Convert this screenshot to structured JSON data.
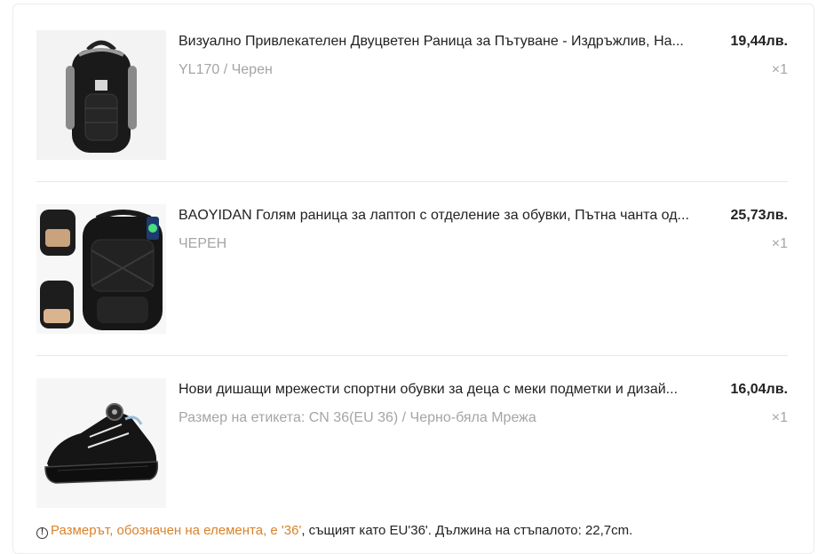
{
  "cart": {
    "items": [
      {
        "title": "Визуално Привлекателен Двуцветен Раница за Пътуване - Издръжлив, На...",
        "price": "19,44лв.",
        "variant": "YL170 / Черен",
        "qty": "×1",
        "image_icon": "backpack-black-grey-icon"
      },
      {
        "title": "BAOYIDAN Голям раница за лаптоп с отделение за обувки, Пътна чанта од...",
        "price": "25,73лв.",
        "variant": "ЧЕРЕН",
        "qty": "×1",
        "image_icon": "laptop-backpack-usb-icon"
      },
      {
        "title": "Нови дишащи мрежести спортни обувки за деца с меки подметки и дизай...",
        "price": "16,04лв.",
        "variant": "Размер на етикета: CN 36(EU 36) / Черно-бяла Мрежа",
        "qty": "×1",
        "image_icon": "kids-sneaker-icon"
      }
    ],
    "size_note": {
      "icon": "!",
      "warning": "Размерът, обозначен на елемента, е '36'",
      "detail": ", същият като EU'36'. Дължина на стъпалото: 22,7cm."
    }
  },
  "colors": {
    "text": "#222222",
    "muted": "#a5a5a5",
    "warning": "#d9822b",
    "divider": "#e6e6e6"
  }
}
